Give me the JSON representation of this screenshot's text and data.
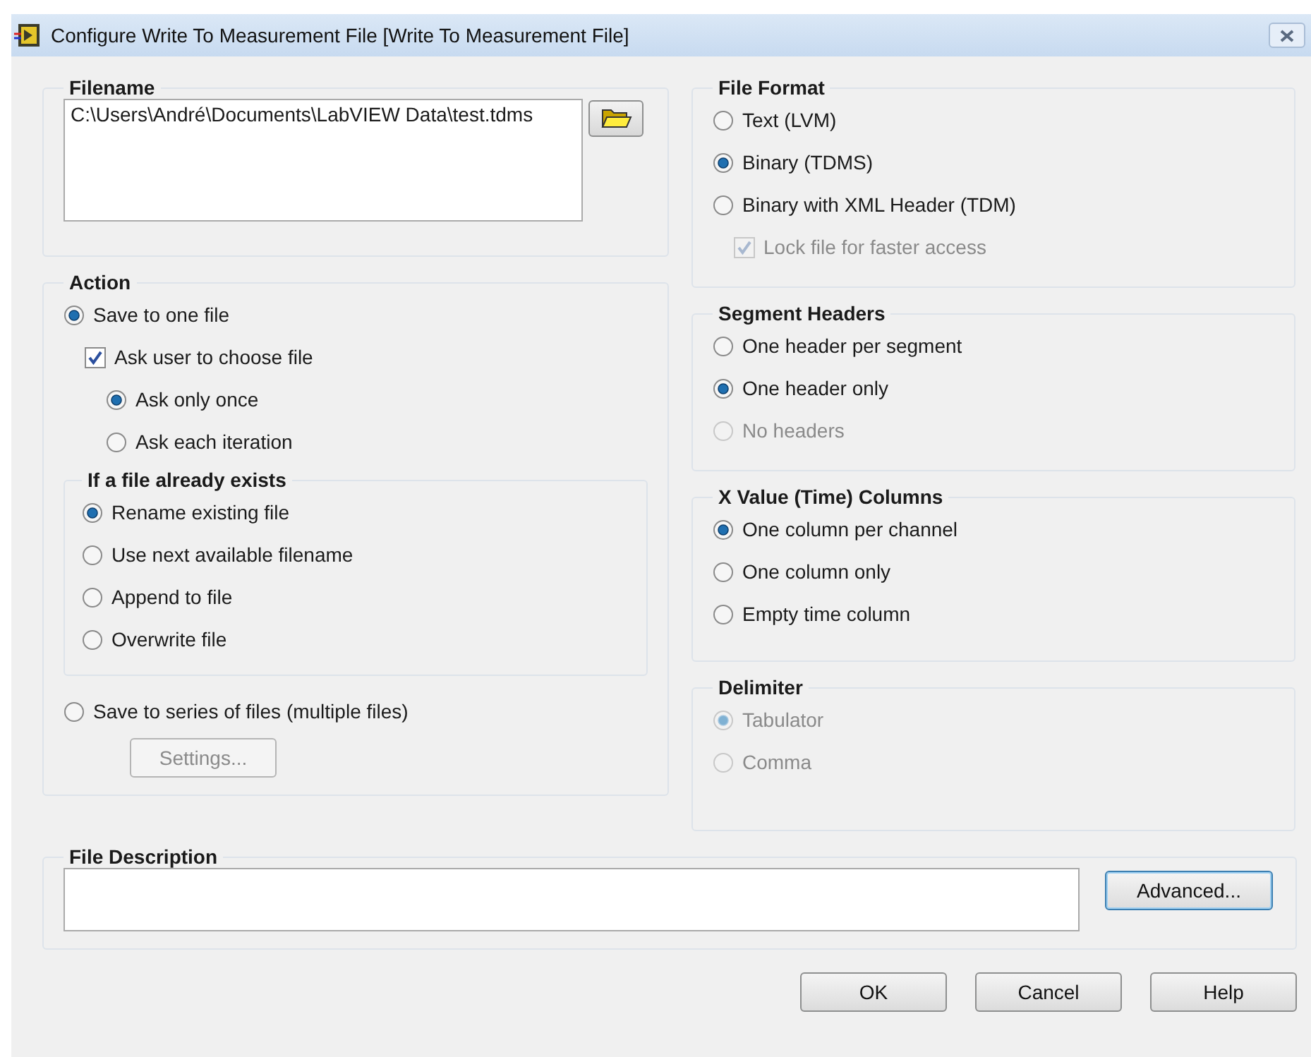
{
  "window": {
    "title": "Configure Write To Measurement File [Write To Measurement File]"
  },
  "filename": {
    "title": "Filename",
    "value": "C:\\Users\\André\\Documents\\LabVIEW Data\\test.tdms"
  },
  "action": {
    "title": "Action",
    "items": [
      {
        "kind": "radio",
        "label": "Save to one file",
        "selected": true,
        "disabled": false,
        "children": [
          {
            "kind": "checkbox",
            "label": "Ask user to choose file",
            "checked": true,
            "disabled": false,
            "children": [
              {
                "kind": "radio",
                "label": "Ask only once",
                "selected": true,
                "disabled": false
              },
              {
                "kind": "radio",
                "label": "Ask each iteration",
                "selected": false,
                "disabled": false
              }
            ]
          }
        ]
      },
      {
        "kind": "group",
        "title": "If a file already exists",
        "children": [
          {
            "kind": "radio",
            "label": "Rename existing file",
            "selected": true,
            "disabled": false
          },
          {
            "kind": "radio",
            "label": "Use next available filename",
            "selected": false,
            "disabled": false
          },
          {
            "kind": "radio",
            "label": "Append to file",
            "selected": false,
            "disabled": false
          },
          {
            "kind": "radio",
            "label": "Overwrite file",
            "selected": false,
            "disabled": false
          }
        ]
      },
      {
        "kind": "radio",
        "label": "Save to series of files (multiple files)",
        "selected": false,
        "disabled": false,
        "children": [
          {
            "kind": "button",
            "label": "Settings...",
            "disabled": true
          }
        ]
      }
    ]
  },
  "file_format": {
    "title": "File Format",
    "items": [
      {
        "kind": "radio",
        "label": "Text (LVM)",
        "selected": false,
        "disabled": false
      },
      {
        "kind": "radio",
        "label": "Binary (TDMS)",
        "selected": true,
        "disabled": false
      },
      {
        "kind": "radio",
        "label": "Binary with XML Header (TDM)",
        "selected": false,
        "disabled": false,
        "children": [
          {
            "kind": "checkbox",
            "label": "Lock file for faster access",
            "checked": true,
            "disabled": true
          }
        ]
      }
    ]
  },
  "segment_headers": {
    "title": "Segment Headers",
    "items": [
      {
        "kind": "radio",
        "label": "One header per segment",
        "selected": false,
        "disabled": false
      },
      {
        "kind": "radio",
        "label": "One header only",
        "selected": true,
        "disabled": false
      },
      {
        "kind": "radio",
        "label": "No headers",
        "selected": false,
        "disabled": true
      }
    ]
  },
  "x_value_columns": {
    "title": "X Value (Time) Columns",
    "items": [
      {
        "kind": "radio",
        "label": "One column per channel",
        "selected": true,
        "disabled": false
      },
      {
        "kind": "radio",
        "label": "One column only",
        "selected": false,
        "disabled": false
      },
      {
        "kind": "radio",
        "label": "Empty time column",
        "selected": false,
        "disabled": false
      }
    ]
  },
  "delimiter": {
    "title": "Delimiter",
    "items": [
      {
        "kind": "radio",
        "label": "Tabulator",
        "selected": true,
        "disabled": true
      },
      {
        "kind": "radio",
        "label": "Comma",
        "selected": false,
        "disabled": true
      }
    ]
  },
  "file_description": {
    "title": "File Description",
    "button": "Advanced..."
  },
  "buttons": [
    "OK",
    "Cancel",
    "Help"
  ]
}
